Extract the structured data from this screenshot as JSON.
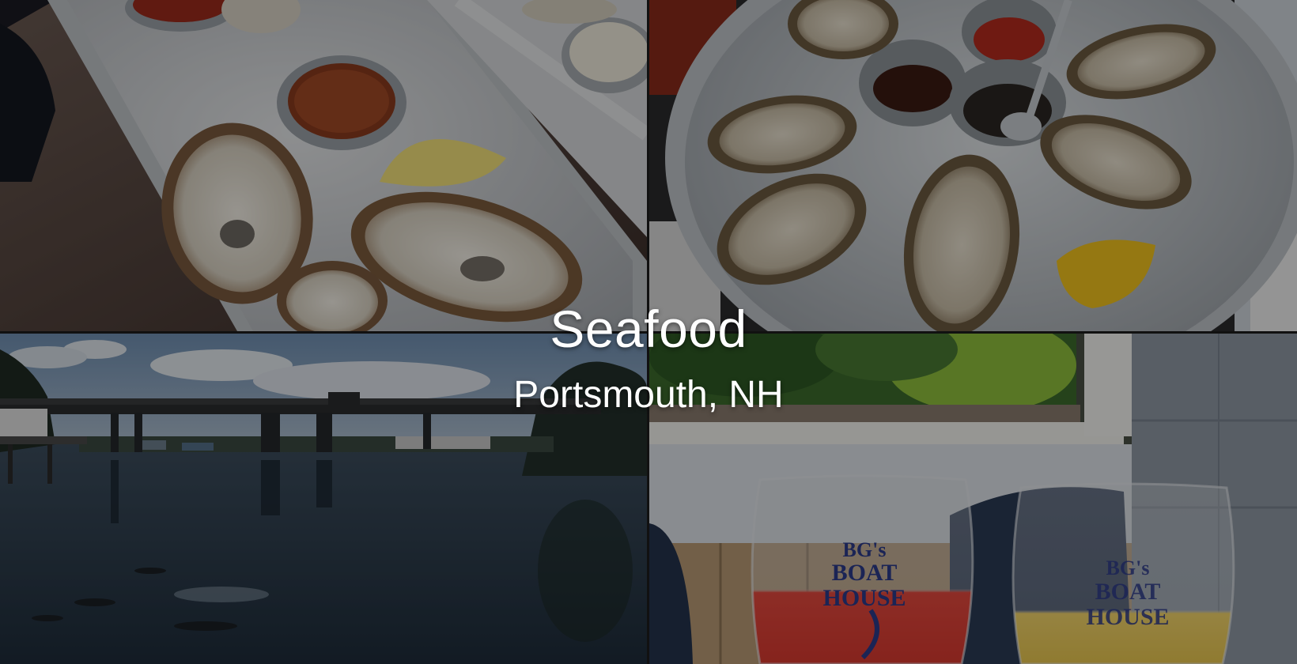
{
  "overlay": {
    "title": "Seafood",
    "subtitle": "Portsmouth, NH"
  },
  "photos": [
    {
      "name": "oysters-tray-photo",
      "icon": "oysters-on-ice-tray"
    },
    {
      "name": "oysters-platter-photo",
      "icon": "oysters-on-round-platter"
    },
    {
      "name": "harbor-bridge-photo",
      "icon": "bridge-over-river"
    },
    {
      "name": "drinks-deck-photo",
      "icon": "wine-glasses-on-deck"
    }
  ],
  "glass_print": {
    "line1": "BG's",
    "line2": "BOAT",
    "line3": "HOUSE"
  },
  "colors": {
    "text": "#ffffff",
    "overlay": "rgba(0,0,0,0.38)",
    "ice": "#c9ced3",
    "water": "#2f4152",
    "sky": "#7e9ab8"
  }
}
